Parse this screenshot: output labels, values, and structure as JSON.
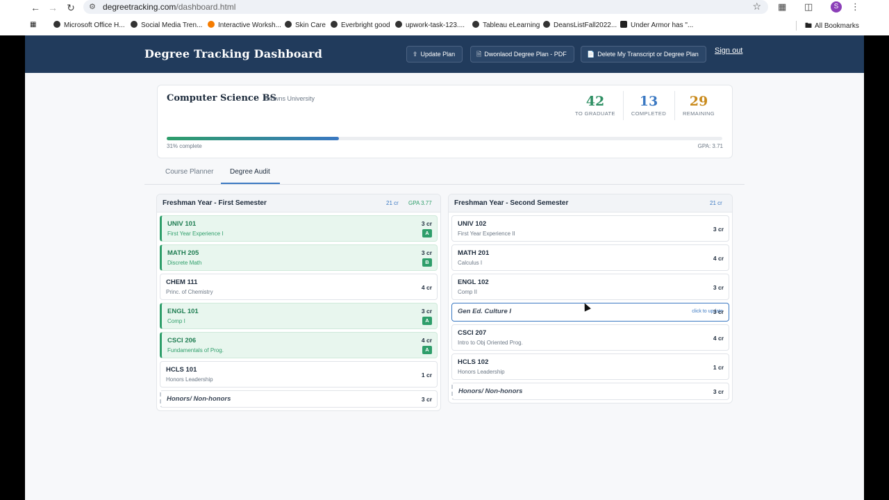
{
  "browser": {
    "url_host": "degreetracking.com",
    "url_path": "/dashboard.html",
    "profile_initial": "S",
    "bookmarks": [
      "Microsoft Office H...",
      "Social Media Tren...",
      "Interactive Worksh...",
      "Skin Care",
      "Everbright good",
      "upwork-task-123....",
      "Tableau eLearning",
      "DeansListFall2022...",
      "Under Armor has \"...",
      "All Bookmarks"
    ]
  },
  "header": {
    "brand": "Degree Tracking Dashboard",
    "update_plan": "Update Plan",
    "download_plan": "Dwonlaod Degree Plan - PDF",
    "delete_transcript": "Delete My Transcript or Degree Plan",
    "sign_out": "Sign out"
  },
  "summary": {
    "degree": "Computer Science BS",
    "university": "Browns University",
    "to_graduate": "42",
    "to_graduate_label": "TO GRADUATE",
    "completed": "13",
    "completed_label": "COMPLETED",
    "remaining": "29",
    "remaining_label": "REMAINING",
    "progress_percent": 31,
    "progress_label": "31% complete",
    "gpa_label": "GPA: 3.71"
  },
  "colors": {
    "header_bg": "#213b5c",
    "to_graduate": "#2e8f63",
    "completed": "#3a78c2",
    "remaining": "#c98a1c",
    "done_green": "#2e9e6a"
  },
  "tabs": [
    "Course Planner",
    "Degree Audit"
  ],
  "semesters": [
    {
      "title": "Freshman Year - First Semester",
      "credits": "21 cr",
      "gpa": "GPA 3.77",
      "courses": [
        {
          "code": "UNIV 101",
          "name": "First Year Experience I",
          "cr": "3 cr",
          "grade": "A"
        },
        {
          "code": "MATH 205",
          "name": "Discrete Math",
          "cr": "3 cr",
          "grade": "B"
        },
        {
          "code": "CHEM 111",
          "name": "Princ. of Chemistry",
          "cr": "4 cr"
        },
        {
          "code": "ENGL 101",
          "name": "Comp I",
          "cr": "3 cr",
          "grade": "A"
        },
        {
          "code": "CSCI 206",
          "name": "Fundamentals of Prog.",
          "cr": "4 cr",
          "grade": "A"
        },
        {
          "code": "HCLS 101",
          "name": "Honors Leadership",
          "cr": "1 cr"
        },
        {
          "elective": "Honors/ Non-honors",
          "cr": "3 cr"
        }
      ]
    },
    {
      "title": "Freshman Year - Second Semester",
      "credits": "21 cr",
      "courses": [
        {
          "code": "UNIV 102",
          "name": "First Year Experience II",
          "cr": "3 cr"
        },
        {
          "code": "MATH 201",
          "name": "Calculus I",
          "cr": "4 cr"
        },
        {
          "code": "ENGL 102",
          "name": "Comp II",
          "cr": "3 cr"
        },
        {
          "elective": "Gen Ed. Culture I",
          "cr": "3 cr",
          "hint": "click to update"
        },
        {
          "code": "CSCI 207",
          "name": "Intro to Obj Oriented Prog.",
          "cr": "4 cr"
        },
        {
          "code": "HCLS 102",
          "name": "Honors Leadership",
          "cr": "1 cr"
        },
        {
          "elective": "Honors/ Non-honors",
          "cr": "3 cr"
        }
      ]
    }
  ]
}
